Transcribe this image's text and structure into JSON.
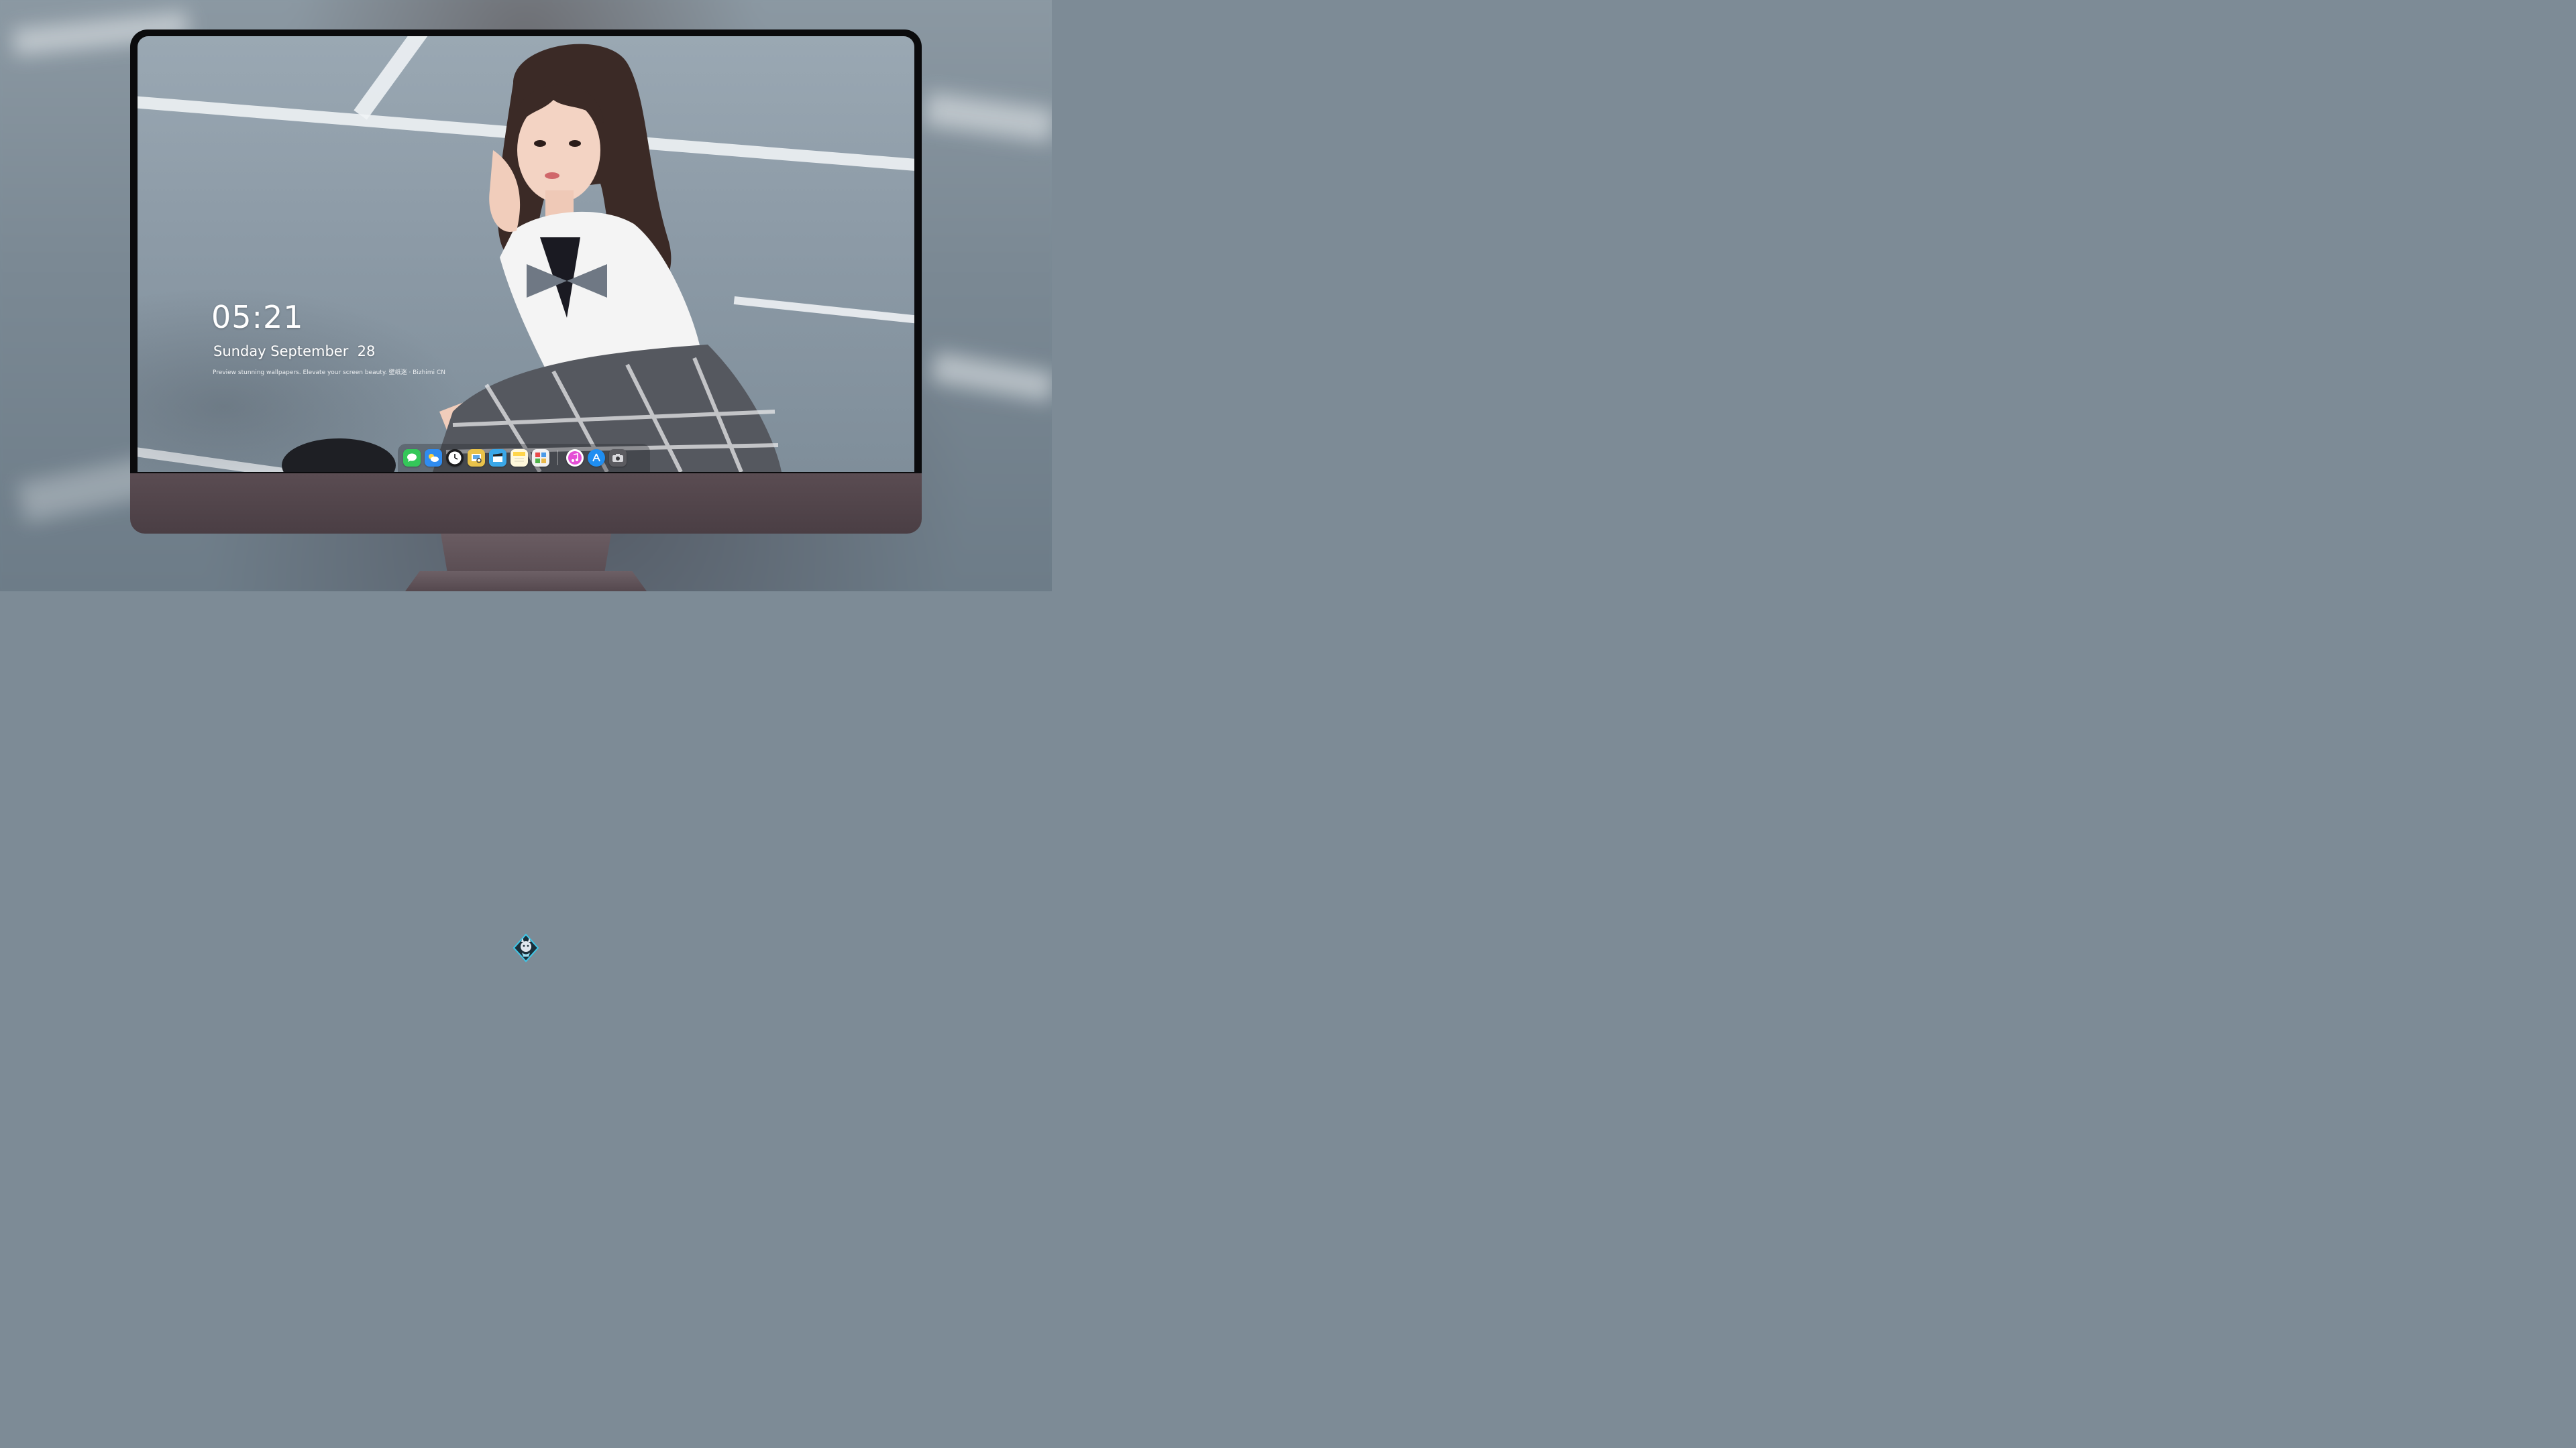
{
  "lockscreen": {
    "time": "05:21",
    "date": "Sunday September  28",
    "caption": "Preview stunning wallpapers. Elevate your screen beauty. 壁纸迷 · Bizhimi CN"
  },
  "dock": {
    "apps": [
      {
        "icon": "messages-icon",
        "color": "#34c759"
      },
      {
        "icon": "weather-icon",
        "color": "#2f8cf0"
      },
      {
        "icon": "clock-icon",
        "color": "#1c1c1e"
      },
      {
        "icon": "preview-icon",
        "color": "#e9c24a"
      },
      {
        "icon": "clips-icon",
        "color": "#3aa7e8"
      },
      {
        "icon": "notes-icon",
        "color": "#ffd54a"
      },
      {
        "icon": "photo-booth-icon",
        "color": "#4f8a3c"
      },
      {
        "icon": "itunes-icon",
        "color": "#e54fd6"
      },
      {
        "icon": "app-store-icon",
        "color": "#1f8ef1"
      },
      {
        "icon": "camera-icon",
        "color": "#5b5b60"
      }
    ]
  },
  "colors": {
    "bezel": "#0b0b0d",
    "chin": "#4f4248",
    "logo_accent": "#3fc7e8"
  }
}
